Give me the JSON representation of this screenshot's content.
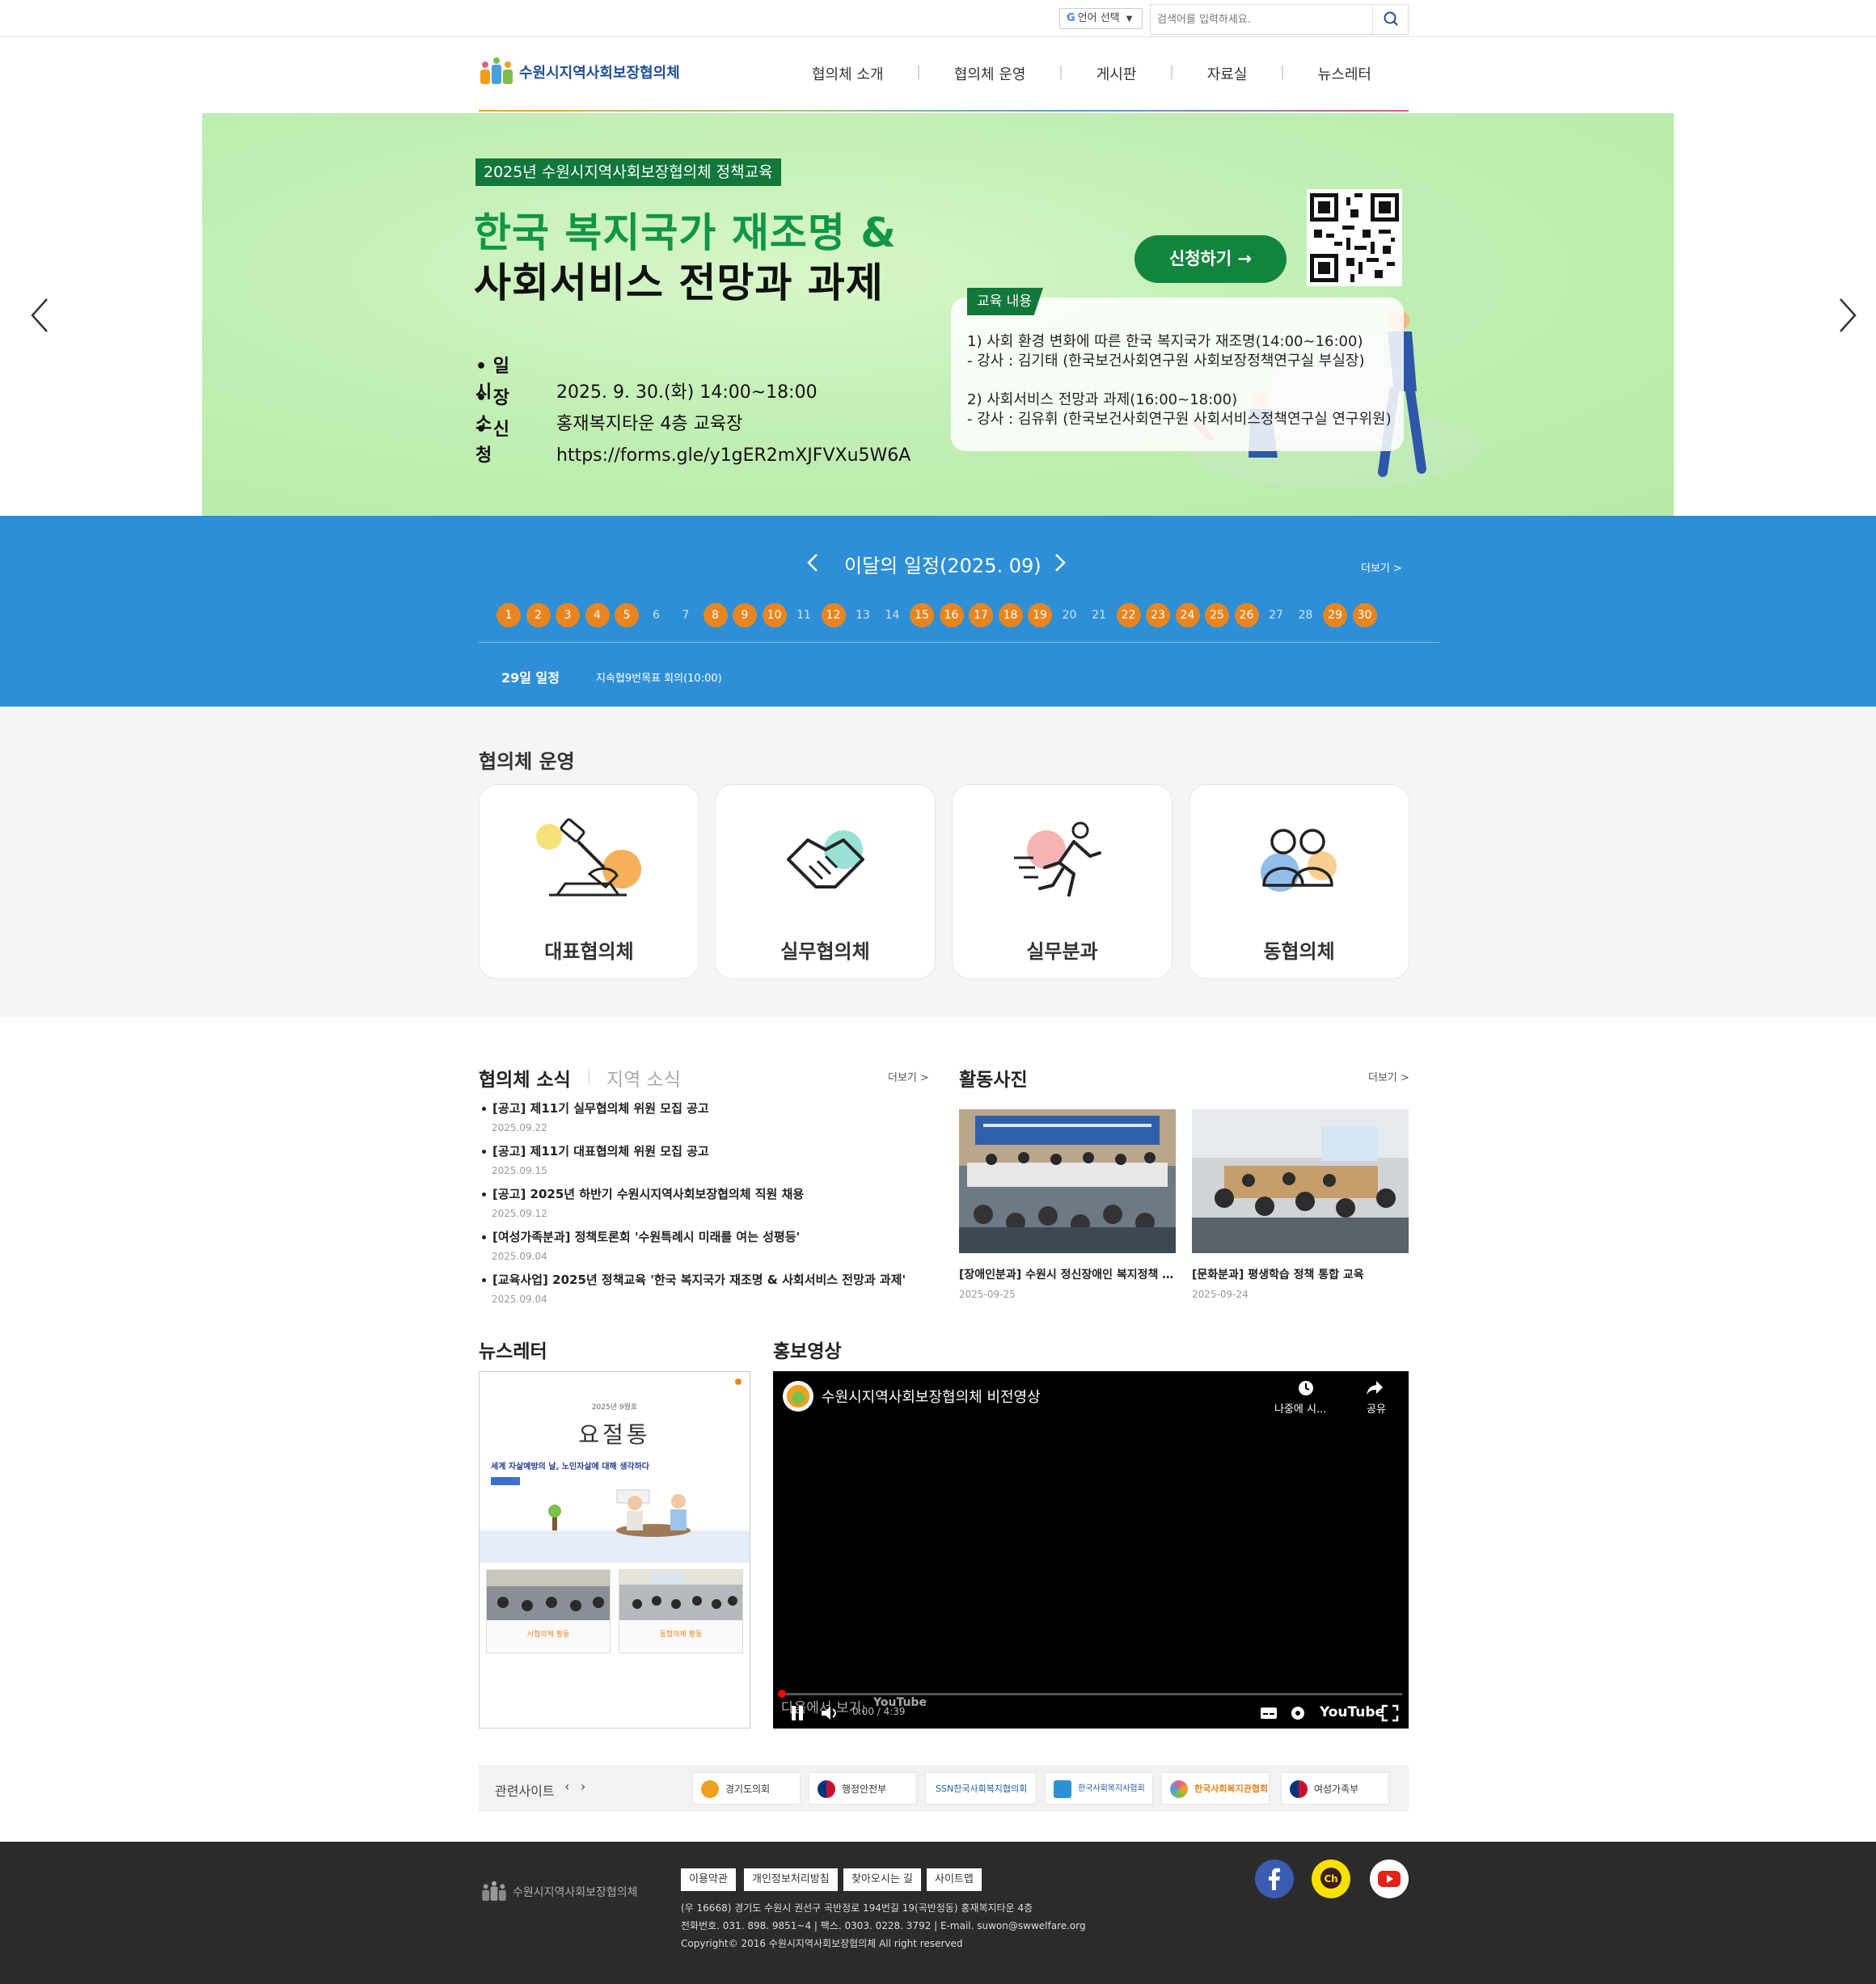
{
  "topbar": {
    "lang_label": "언어 선택",
    "search_placeholder": "검색어를 입력하세요."
  },
  "header": {
    "logo_text": "수원시지역사회보장협의체",
    "nav": [
      "협의체 소개",
      "협의체 운영",
      "게시판",
      "자료실",
      "뉴스레터"
    ]
  },
  "banner": {
    "tag": "2025년 수원시지역사회보장협의체 정책교육",
    "title1": "한국 복지국가 재조명 &",
    "title2": "사회서비스 전망과 과제",
    "info": [
      {
        "k": "• 일　　시",
        "v": "2025. 9. 30.(화) 14:00~18:00"
      },
      {
        "k": "• 장　　소",
        "v": "홍재복지타운 4층 교육장"
      },
      {
        "k": "• 신　　청",
        "v": "https://forms.gle/y1gER2mXJFVXu5W6A"
      }
    ],
    "apply_label": "신청하기",
    "edu_label": "교육 내용",
    "edu_lines": [
      "1) 사회 환경 변화에 따른 한국 복지국가 재조명(14:00~16:00)",
      "  - 강사 : 김기태 (한국보건사회연구원 사회보장정책연구실 부실장)",
      "2) 사회서비스 전망과 과제(16:00~18:00)",
      "  - 강사 : 김유휘 (한국보건사회연구원 사회서비스정책연구실 연구위원)"
    ]
  },
  "schedule": {
    "title": "이달의 일정(2025. 09)",
    "more": "더보기 >",
    "days": [
      1,
      2,
      3,
      4,
      5,
      6,
      7,
      8,
      9,
      10,
      11,
      12,
      13,
      14,
      15,
      16,
      17,
      18,
      19,
      20,
      21,
      22,
      23,
      24,
      25,
      26,
      27,
      28,
      29,
      30
    ],
    "active_days": [
      1,
      2,
      3,
      4,
      5,
      8,
      9,
      10,
      12,
      15,
      16,
      17,
      18,
      19,
      22,
      23,
      24,
      25,
      26,
      29,
      30
    ],
    "selected_date": "29일 일정",
    "selected_item": "지속협9번목표 회의(10:00)",
    "active_color": "#e98520"
  },
  "ops": {
    "title": "협의체 운영",
    "cards": [
      "대표협의체",
      "실무협의체",
      "실무분과",
      "동협의체"
    ]
  },
  "news": {
    "tab_active": "협의체 소식",
    "tab_inactive": "지역 소식",
    "more": "더보기 >",
    "items": [
      {
        "title": "[공고] 제11기 실무협의체 위원 모집 공고",
        "date": "2025.09.22"
      },
      {
        "title": "[공고] 제11기 대표협의체 위원 모집 공고",
        "date": "2025.09.15"
      },
      {
        "title": "[공고] 2025년 하반기 수원시지역사회보장협의체 직원 채용",
        "date": "2025.09.12"
      },
      {
        "title": "[여성가족분과] 정책토론회 '수원특례시 미래를 여는 성평등'",
        "date": "2025.09.04"
      },
      {
        "title": "[교육사업] 2025년 정책교육 '한국 복지국가 재조명 & 사회서비스 전망과 과제'",
        "date": "2025.09.04"
      }
    ]
  },
  "photos": {
    "title": "활동사진",
    "more": "더보기 >",
    "items": [
      {
        "caption": "[장애인분과] 수원시 정신장애인 복지정책 …",
        "date": "2025-09-25"
      },
      {
        "caption": "[문화분과] 평생학습 정책 통합 교육",
        "date": "2025-09-24"
      }
    ]
  },
  "newsletter": {
    "title": "뉴스레터",
    "issue": "2025년 9월호",
    "heading": "요절통",
    "subtitle": "세계 자살예방의 날, 노인자살에 대해 생각하다",
    "photo_caps": [
      "시협의체 활동",
      "동협의체 활동"
    ]
  },
  "video": {
    "section_title": "홍보영상",
    "title": "수원시지역사회보장협의체 비전영상",
    "later": "나중에 시...",
    "share": "공유",
    "time": "0:00 / 4:39",
    "watch_on": "다음에서 보기:",
    "brand": "YouTube"
  },
  "related": {
    "label": "관련사이트",
    "sites": [
      "경기도의회",
      "행정안전부",
      "SSN한국사회복지협의회",
      "한국사회복지사협회",
      "한국사회복지관협회",
      "여성가족부"
    ]
  },
  "footer": {
    "logo_text": "수원시지역사회보장협의체",
    "links": [
      "이용약관",
      "개인정보처리방침",
      "찾아오시는 길",
      "사이트맵"
    ],
    "address": "(우 16668) 경기도 수원시 권선구 곡반정로 194번길 19(곡반정동) 홍재복지타운 4층",
    "contact": "전화번호. 031. 898. 9851~4  |  팩스. 0303. 0228. 3792  |  E-mail. suwon@swwelfare.org",
    "copyright": "Copyright© 2016 수원시지역사회보장협의체 All right reserved"
  }
}
